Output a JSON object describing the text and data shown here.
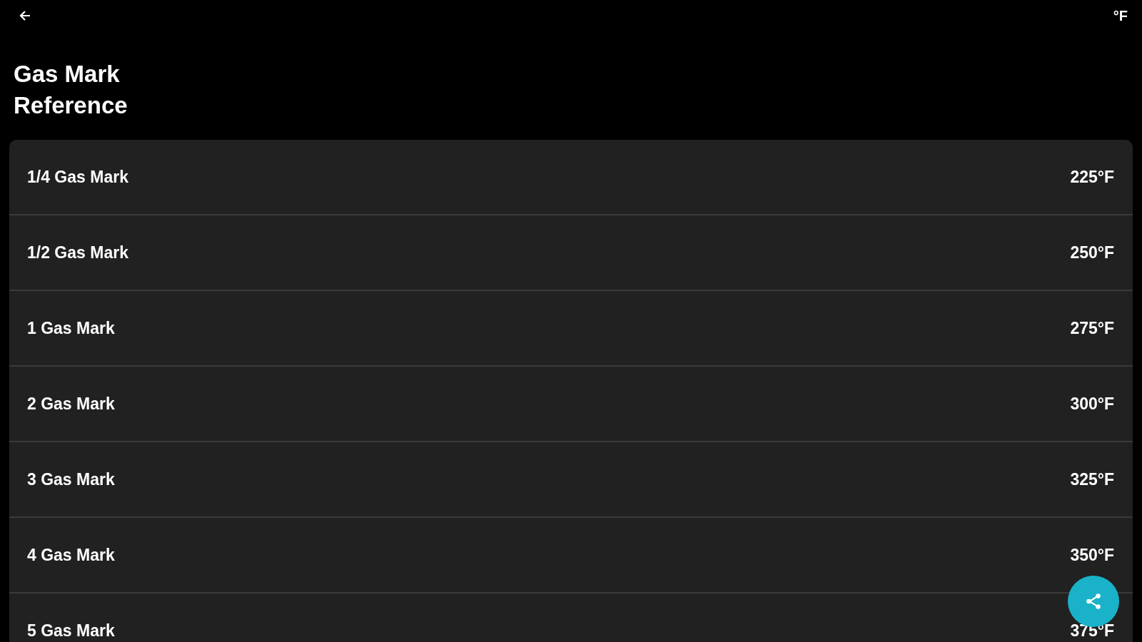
{
  "top_bar": {
    "unit_toggle": "°F"
  },
  "title": "Gas Mark Reference",
  "rows": [
    {
      "label": "1/4 Gas Mark",
      "value": "225°F"
    },
    {
      "label": "1/2 Gas Mark",
      "value": "250°F"
    },
    {
      "label": "1 Gas Mark",
      "value": "275°F"
    },
    {
      "label": "2 Gas Mark",
      "value": "300°F"
    },
    {
      "label": "3 Gas Mark",
      "value": "325°F"
    },
    {
      "label": "4 Gas Mark",
      "value": "350°F"
    },
    {
      "label": "5 Gas Mark",
      "value": "375°F"
    }
  ]
}
